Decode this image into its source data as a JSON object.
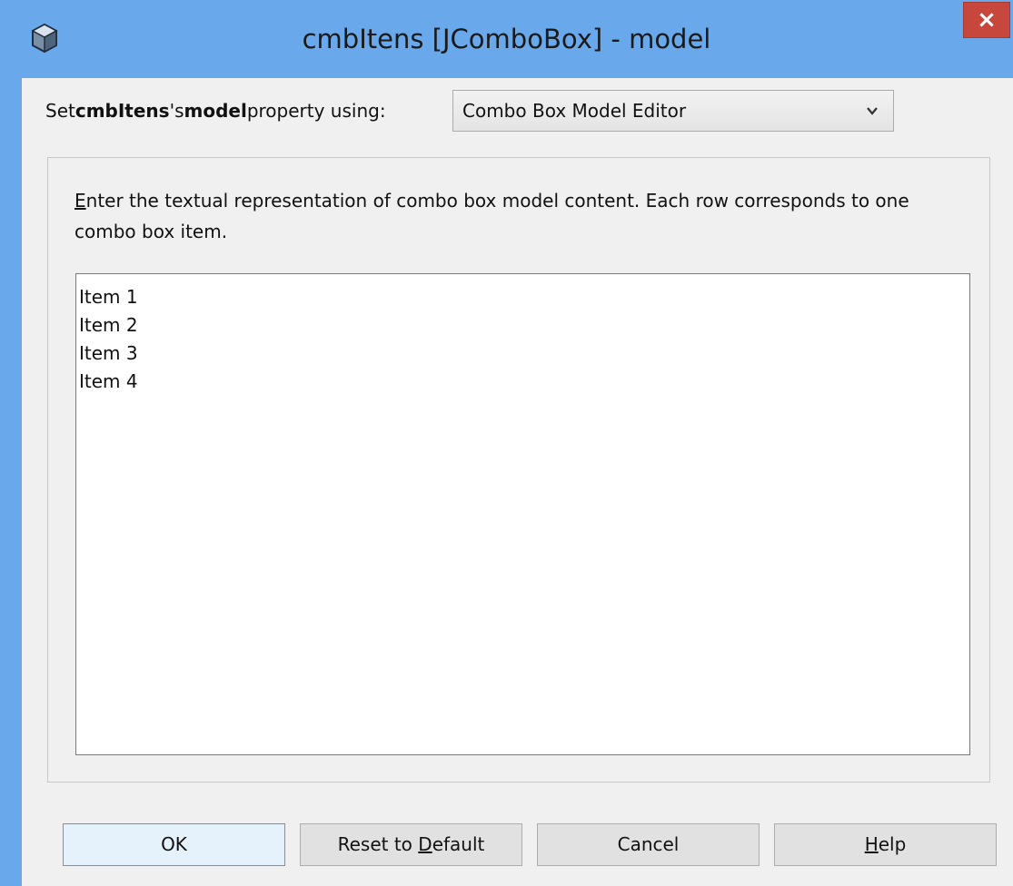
{
  "window": {
    "title": "cmbItens [JComboBox] - model",
    "close_label": "×"
  },
  "selector": {
    "prefix": "Set ",
    "component": "cmbItens",
    "possessive": "'s ",
    "property": "model",
    "suffix": " property using:",
    "value": "Combo Box Model Editor"
  },
  "editor": {
    "instructions_mnemonic": "E",
    "instructions_rest": "nter the textual representation of combo box model content. Each row corresponds to one combo box item.",
    "items": [
      "Item 1",
      "Item 2",
      "Item 3",
      "Item 4"
    ]
  },
  "buttons": {
    "ok": "OK",
    "reset_pre": "Reset to ",
    "reset_mnemonic": "D",
    "reset_post": "efault",
    "cancel": "Cancel",
    "help_mnemonic": "H",
    "help_post": "elp"
  }
}
